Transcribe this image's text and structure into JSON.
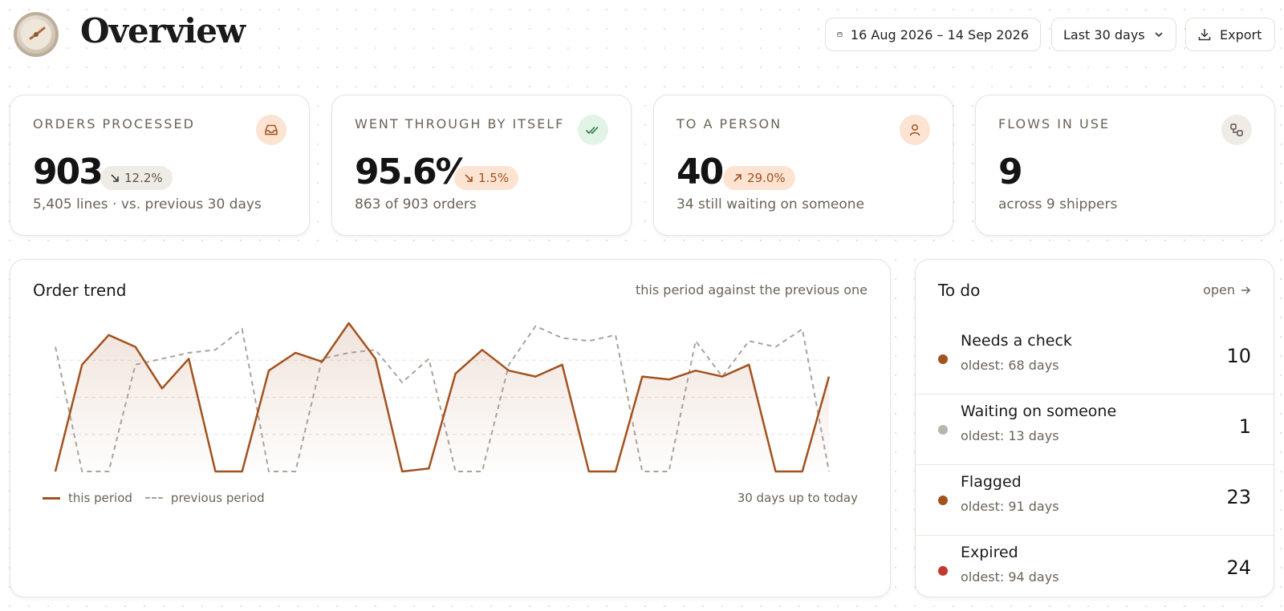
{
  "header": {
    "title": "Overview",
    "date_range": "16 Aug 2026 – 14 Sep 2026",
    "period_select": "Last 30 days",
    "export_label": "Export"
  },
  "colors": {
    "accent": "#a2521f",
    "previous": "#a9a39b",
    "up_badge_bg": "#fde3d2",
    "down_badge_bg": "#efece6",
    "ok_icon_bg": "#e2f4e6",
    "neutral_icon_bg": "#efece6",
    "red_dot": "#c4392f",
    "grey_dot": "#b8b4ae"
  },
  "metrics": [
    {
      "label": "ORDERS PROCESSED",
      "value": "903",
      "badge": "12.2%",
      "badge_dir": "down",
      "sub": "5,405 lines · vs. previous 30 days",
      "icon": "inbox-icon"
    },
    {
      "label": "WENT THROUGH BY ITSELF",
      "value": "95.6%",
      "badge": "1.5%",
      "badge_dir": "down",
      "sub": "863 of 903 orders",
      "icon": "double-check-icon"
    },
    {
      "label": "TO A PERSON",
      "value": "40",
      "badge": "29.0%",
      "badge_dir": "up",
      "sub": "34 still waiting on someone",
      "icon": "person-icon"
    },
    {
      "label": "FLOWS IN USE",
      "value": "9",
      "sub": "across 9 shippers",
      "icon": "flow-icon"
    }
  ],
  "trend": {
    "title": "Order trend",
    "note": "this period against the previous one",
    "legend_current": "this period",
    "legend_previous": "previous period",
    "footer": "30 days up to today"
  },
  "chart_data": {
    "type": "line",
    "x": [
      1,
      2,
      3,
      4,
      5,
      6,
      7,
      8,
      9,
      10,
      11,
      12,
      13,
      14,
      15,
      16,
      17,
      18,
      19,
      20,
      21,
      22,
      23,
      24,
      25,
      26,
      27,
      28,
      29,
      30
    ],
    "ylim": [
      0,
      50
    ],
    "series": [
      {
        "name": "this period",
        "values": [
          0,
          36,
          46,
          42,
          28,
          38,
          0,
          0,
          34,
          40,
          37,
          50,
          38,
          0,
          1,
          33,
          41,
          34,
          32,
          36,
          0,
          0,
          32,
          31,
          34,
          32,
          36,
          0,
          0,
          32
        ]
      },
      {
        "name": "previous period",
        "values": [
          42,
          0,
          0,
          36,
          38,
          40,
          41,
          48,
          0,
          0,
          38,
          40,
          41,
          30,
          38,
          0,
          0,
          36,
          49,
          45,
          44,
          46,
          0,
          0,
          44,
          32,
          44,
          42,
          48,
          0
        ]
      }
    ]
  },
  "todo": {
    "title": "To do",
    "open_label": "open",
    "items": [
      {
        "title": "Needs a check",
        "sub": "oldest: 68 days",
        "count": "10",
        "dot": "#a2521f"
      },
      {
        "title": "Waiting on someone",
        "sub": "oldest: 13 days",
        "count": "1",
        "dot": "#b8b4ae"
      },
      {
        "title": "Flagged",
        "sub": "oldest: 91 days",
        "count": "23",
        "dot": "#a2521f"
      },
      {
        "title": "Expired",
        "sub": "oldest: 94 days",
        "count": "24",
        "dot": "#c4392f"
      }
    ]
  }
}
